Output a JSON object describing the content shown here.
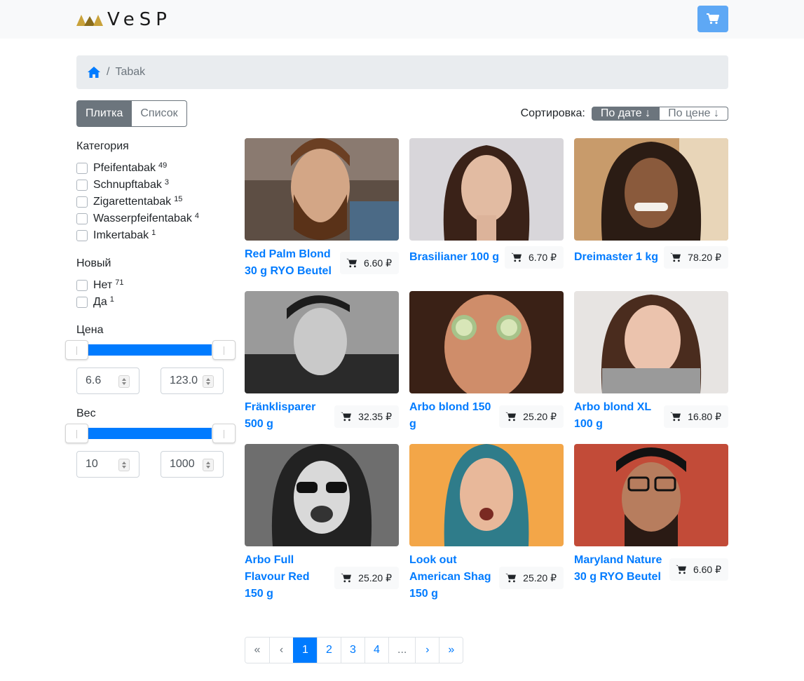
{
  "brand": {
    "name": "VeSP",
    "accent": "#c9a23a"
  },
  "colors": {
    "primary": "#007bff",
    "secondary": "#6c757d",
    "cart_button": "#5ea8f5"
  },
  "header": {
    "cart_icon": "cart-icon"
  },
  "breadcrumb": {
    "home_icon": "home-icon",
    "current": "Tabak"
  },
  "view": {
    "tiles": "Плитка",
    "list": "Список",
    "active": "tiles"
  },
  "sort": {
    "label": "Сортировка:",
    "by_date": "По дате ↓",
    "by_price": "По цене ↓",
    "active": "by_date"
  },
  "filters": {
    "category": {
      "title": "Категория",
      "items": [
        {
          "label": "Pfeifentabak",
          "count": "49",
          "checked": false
        },
        {
          "label": "Schnupftabak",
          "count": "3",
          "checked": false
        },
        {
          "label": "Zigarettentabak",
          "count": "15",
          "checked": false
        },
        {
          "label": "Wasserpfeifentabak",
          "count": "4",
          "checked": false
        },
        {
          "label": "Imkertabak",
          "count": "1",
          "checked": false
        }
      ]
    },
    "new": {
      "title": "Новый",
      "items": [
        {
          "label": "Нет",
          "count": "71",
          "checked": false
        },
        {
          "label": "Да",
          "count": "1",
          "checked": false
        }
      ]
    },
    "price": {
      "title": "Цена",
      "min": "6.6",
      "max": "123.0"
    },
    "weight": {
      "title": "Вес",
      "min": "10",
      "max": "1000"
    }
  },
  "products": [
    {
      "name": "Red Palm Blond 30 g RYO Beutel",
      "price": "6.60 ₽"
    },
    {
      "name": "Brasilianer 100 g",
      "price": "6.70 ₽"
    },
    {
      "name": "Dreimaster 1 kg",
      "price": "78.20 ₽"
    },
    {
      "name": "Fränklisparer 500 g",
      "price": "32.35 ₽"
    },
    {
      "name": "Arbo blond 150 g",
      "price": "25.20 ₽"
    },
    {
      "name": "Arbo blond XL 100 g",
      "price": "16.80 ₽"
    },
    {
      "name": "Arbo Full Flavour Red 150 g",
      "price": "25.20 ₽"
    },
    {
      "name": "Look out American Shag 150 g",
      "price": "25.20 ₽"
    },
    {
      "name": "Maryland Nature 30 g RYO Beutel",
      "price": "6.60 ₽"
    }
  ],
  "pagination": {
    "first": "«",
    "prev": "‹",
    "pages": [
      "1",
      "2",
      "3",
      "4"
    ],
    "ellipsis": "...",
    "next": "›",
    "last": "»",
    "current": "1"
  }
}
